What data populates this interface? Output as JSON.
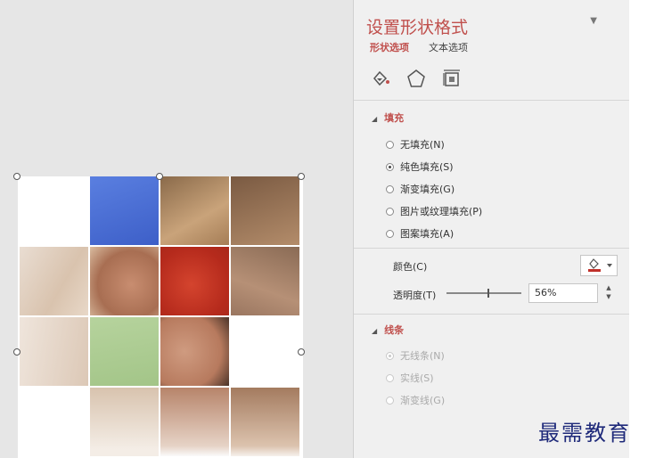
{
  "pane": {
    "title": "设置形状格式",
    "tabs": {
      "shape": "形状选项",
      "text": "文本选项"
    },
    "icons": [
      "fill-line-icon",
      "effects-pentagon-icon",
      "size-properties-icon"
    ]
  },
  "fill": {
    "heading": "填充",
    "options": [
      {
        "label": "无填充(N)",
        "checked": false
      },
      {
        "label": "纯色填充(S)",
        "checked": true
      },
      {
        "label": "渐变填充(G)",
        "checked": false
      },
      {
        "label": "图片或纹理填充(P)",
        "checked": false
      },
      {
        "label": "图案填充(A)",
        "checked": false
      }
    ],
    "color_label": "颜色(C)",
    "transparency_label": "透明度(T)",
    "transparency_value": "56%",
    "transparency_fraction": 0.56
  },
  "line": {
    "heading": "线条",
    "options": [
      {
        "label": "无线条(N)",
        "checked": true
      },
      {
        "label": "实线(S)",
        "checked": false
      },
      {
        "label": "渐变线(G)",
        "checked": false
      }
    ]
  },
  "watermark": "最需教育",
  "colors": {
    "accent": "#c0504d",
    "blue_overlay": "#4a6fd8",
    "red_overlay": "#d22c1e",
    "green_overlay": "#a8d08d"
  }
}
